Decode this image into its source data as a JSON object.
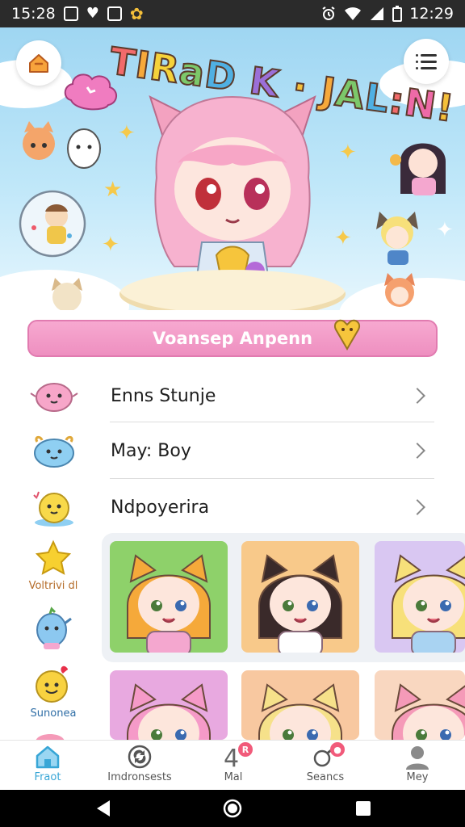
{
  "status_bar": {
    "time": "15:28",
    "clock": "12:29",
    "icons": [
      "image-icon",
      "heart-icon",
      "sim-icon",
      "flower-icon",
      "alarm-icon",
      "wifi-icon",
      "signal-icon",
      "battery-icon"
    ]
  },
  "hero": {
    "title": "TIRaD K · JAL:N!",
    "title_parts": [
      {
        "text": "T",
        "color": "#f26b6b"
      },
      {
        "text": "I",
        "color": "#f6a93b"
      },
      {
        "text": "R",
        "color": "#f5d23a"
      },
      {
        "text": "a",
        "color": "#7cc86a"
      },
      {
        "text": "D",
        "color": "#4fb0e3"
      },
      {
        "text": " K",
        "color": "#9b6fd8"
      },
      {
        "text": " · ",
        "color": "#f5c03a"
      },
      {
        "text": "J",
        "color": "#f6a93b"
      },
      {
        "text": "A",
        "color": "#7cc86a"
      },
      {
        "text": "L",
        "color": "#4fb0e3"
      },
      {
        "text": ":",
        "color": "#f26b6b"
      },
      {
        "text": "N",
        "color": "#ee6aa7"
      },
      {
        "text": "!",
        "color": "#f5c03a"
      }
    ],
    "home_icon": "home-icon",
    "menu_icon": "menu-icon"
  },
  "feature_button": {
    "label": "Voansep Anpenn"
  },
  "list": [
    {
      "label": "Enns Stunje",
      "icon": "pink-blob-icon",
      "color": "#f7a6c9"
    },
    {
      "label": "May: Boy",
      "icon": "blue-blob-icon",
      "color": "#8fcff2"
    },
    {
      "label": "Ndpoyerira",
      "icon": "yellow-blob-icon",
      "color": "#f8d94a"
    }
  ],
  "rail": [
    {
      "label": "Voltrivi dl",
      "icon": "star-icon"
    },
    {
      "label": "",
      "icon": "blue-creature-icon"
    },
    {
      "label": "Sunonea",
      "icon": "sun-face-icon"
    }
  ],
  "grid": [
    {
      "name": "orange-cat-girl",
      "bg": "#8ed16a",
      "hair": "#f5a93a",
      "outfit": "#f4a7cf"
    },
    {
      "name": "dark-hair-cat-girl",
      "bg": "#f8c98a",
      "hair": "#3a2a2a",
      "outfit": "#ffffff"
    },
    {
      "name": "blonde-pair",
      "bg": "#d9c7f2",
      "hair": "#f7e07a",
      "outfit": "#a9d3f2"
    },
    {
      "name": "pink-cat-girl",
      "bg": "#e8a9e0",
      "hair": "#f59ac8",
      "outfit": "#f7c6e0"
    },
    {
      "name": "blonde-cat-girl",
      "bg": "#f8c8a0",
      "hair": "#f6e18a",
      "outfit": "#f3b9d4"
    },
    {
      "name": "pink-blob-plant",
      "bg": "#f9d7c0",
      "hair": "#f59ab8",
      "outfit": "#7cc86a"
    }
  ],
  "bottom_nav": [
    {
      "label": "Fraot",
      "icon": "home-nav-icon",
      "active": true
    },
    {
      "label": "Imdronsests",
      "icon": "refresh-icon",
      "active": false
    },
    {
      "label": "Mal",
      "icon": "mail-icon",
      "active": false,
      "badge": "4"
    },
    {
      "label": "Seancs",
      "icon": "search-icon",
      "active": false
    },
    {
      "label": "Mey",
      "icon": "profile-icon",
      "active": false
    }
  ],
  "system_nav": [
    "back-icon",
    "home-circle-icon",
    "recents-icon"
  ],
  "colors": {
    "accent_pink": "#ee8fc0",
    "nav_active": "#38a6d6",
    "sky": "#9fd6f2"
  }
}
